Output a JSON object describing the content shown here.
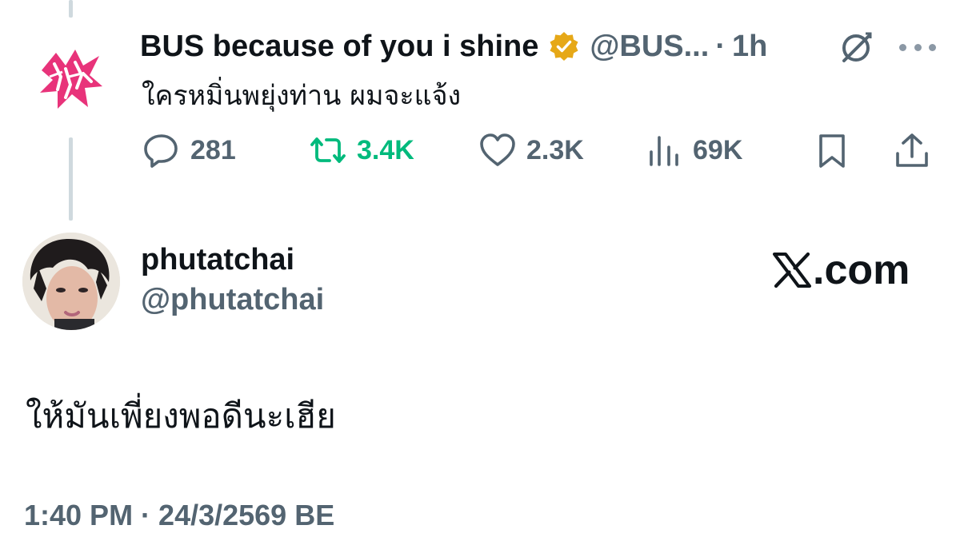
{
  "quoted_tweet": {
    "display_name": "BUS because of you i shine",
    "handle": "@BUS...",
    "separator": "·",
    "time": "1h",
    "text": "ใครหมิ่นพยุ่งท่าน ผมจะแจ้ง",
    "stats": {
      "replies": "281",
      "retweets": "3.4K",
      "likes": "2.3K",
      "views": "69K"
    },
    "colors": {
      "verified": "#e6a817",
      "retweet_active": "#00ba7c",
      "logo_pink": "#e8337a"
    }
  },
  "reply": {
    "display_name": "phutatchai",
    "handle": "@phutatchai",
    "text": "ให้มันเพี่ยงพอดีนะเฮีย",
    "timestamp": "1:40 PM · 24/3/2569 BE"
  },
  "brand": {
    "label": ".com"
  },
  "icons": {
    "grok": "grok-icon",
    "more": "more-icon",
    "reply": "reply-icon",
    "retweet": "retweet-icon",
    "like": "heart-icon",
    "views": "views-icon",
    "bookmark": "bookmark-icon",
    "share": "share-icon",
    "x_logo": "x-logo-icon"
  }
}
